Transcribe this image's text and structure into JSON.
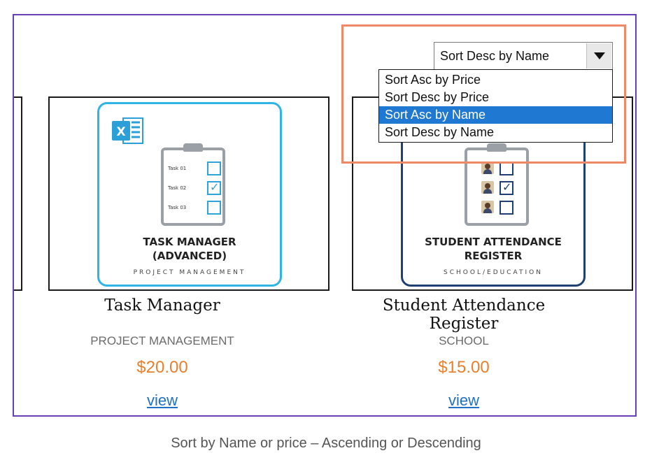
{
  "sort": {
    "selected_label": "Sort Desc by Name",
    "options": [
      {
        "label": "Sort Asc by Price"
      },
      {
        "label": "Sort Desc by Price"
      },
      {
        "label": "Sort Asc by Name",
        "highlighted": true
      },
      {
        "label": "Sort Desc by Name"
      }
    ]
  },
  "products": [
    {
      "thumb_title_line1": "TASK MANAGER",
      "thumb_title_line2": "(ADVANCED)",
      "thumb_subtitle": "PROJECT MANAGEMENT",
      "tasks": [
        "Task 01",
        "Task 02",
        "Task 03"
      ],
      "name": "Task Manager",
      "category": "PROJECT MANAGEMENT",
      "price": "$20.00",
      "link": "view"
    },
    {
      "thumb_title_line1": "STUDENT ATTENDANCE",
      "thumb_title_line2": "REGISTER",
      "thumb_subtitle": "SCHOOL/EDUCATION",
      "name": "Student Attendance Register",
      "category": "SCHOOL",
      "price": "$15.00",
      "link": "view"
    }
  ],
  "caption": "Sort by Name or price – Ascending or Descending",
  "colors": {
    "frame": "#6a3fb8",
    "highlight_box": "#ee8866",
    "price": "#e8802e",
    "link": "#2070c8",
    "selected_option_bg": "#1f78d1",
    "excel_green": "#1f9ad6"
  }
}
